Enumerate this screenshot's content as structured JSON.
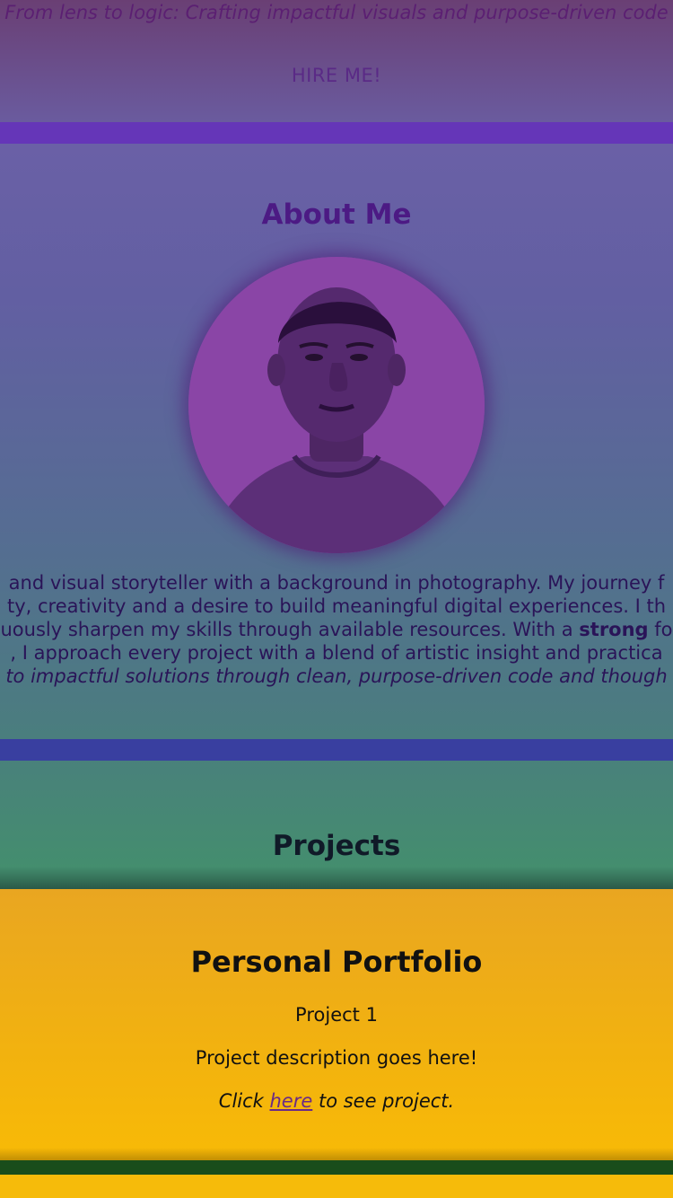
{
  "hero": {
    "tagline": "From lens to logic: Crafting impactful visuals and purpose-driven code",
    "hire_label": "HIRE ME!"
  },
  "about": {
    "title": "About Me",
    "avatar_alt": "portrait",
    "bio_lines": [
      "and visual storyteller with a background in photography. My journey f",
      "ty, creativity and a desire to build meaningful digital experiences. I th",
      "uously sharpen my skills through available resources. With a ",
      ", I approach every project with a blend of artistic insight and practica",
      "to impactful solutions through clean, purpose-driven code and though"
    ],
    "bio_strong": "strong",
    "bio_line3_tail": " fo"
  },
  "projects": {
    "title": "Projects",
    "items": [
      {
        "title": "Personal Portfolio",
        "subtitle": "Project 1",
        "description": "Project description goes here!",
        "link_prefix": "Click ",
        "link_text": "here",
        "link_suffix": " to see project."
      }
    ]
  },
  "colors": {
    "accent_purple": "#6536b8",
    "divider_blue": "#393fa0",
    "card_yellow": "#f2b20f",
    "title_purple": "#4c1a84"
  }
}
